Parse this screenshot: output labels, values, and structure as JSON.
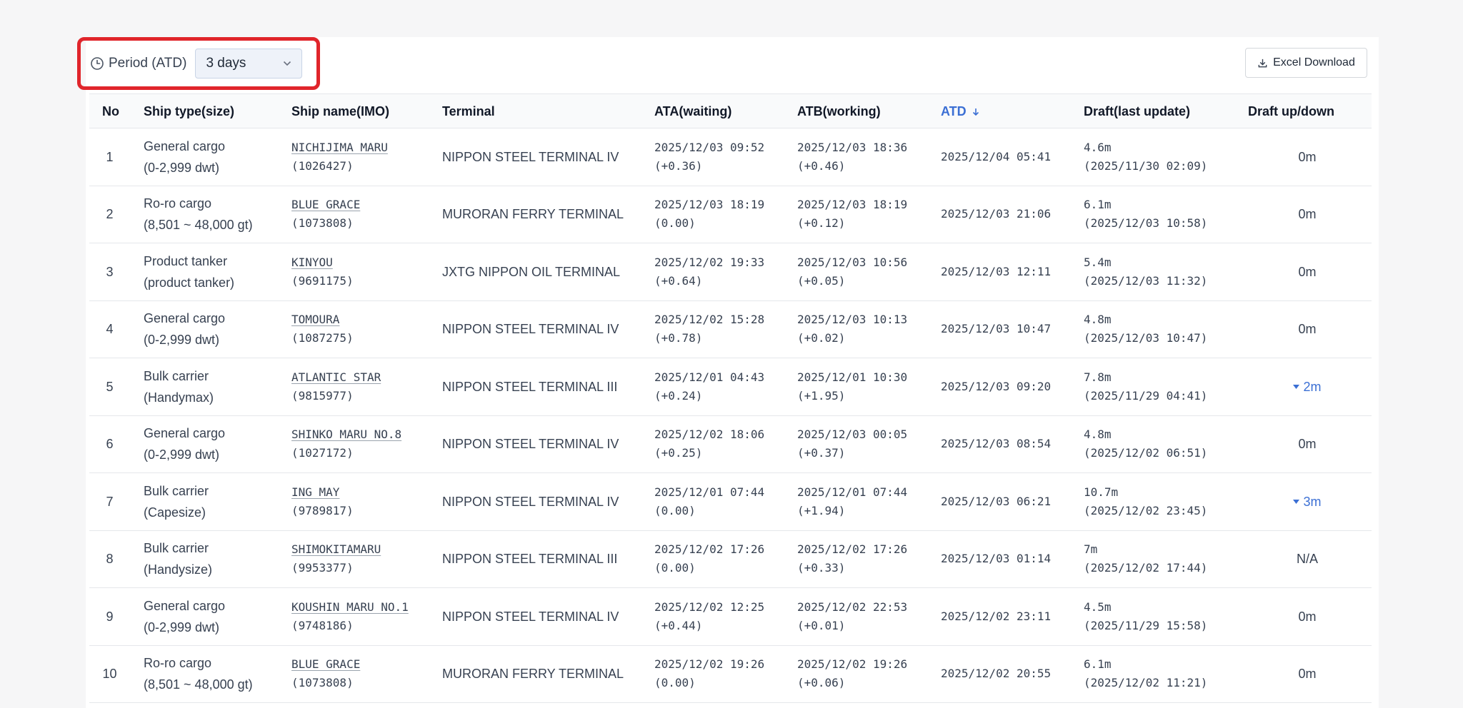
{
  "toolbar": {
    "period_label": "Period (ATD)",
    "period_value": "3 days",
    "excel_label": "Excel Download"
  },
  "columns": {
    "no": "No",
    "ship_type": "Ship type(size)",
    "ship_name": "Ship name(IMO)",
    "terminal": "Terminal",
    "ata": "ATA(waiting)",
    "atb": "ATB(working)",
    "atd": "ATD",
    "draft": "Draft(last update)",
    "updown": "Draft up/down"
  },
  "rows": [
    {
      "no": "1",
      "type": "General cargo",
      "size": "(0-2,999 dwt)",
      "name": "NICHIJIMA MARU",
      "imo": "(1026427)",
      "terminal": "NIPPON STEEL TERMINAL IV",
      "ata": "2025/12/03 09:52",
      "ata_wait": "(+0.36)",
      "atb": "2025/12/03 18:36",
      "atb_work": "(+0.46)",
      "atd": "2025/12/04 05:41",
      "draft": "4.6m",
      "draft_update": "(2025/11/30 02:09)",
      "updown": "0m",
      "updown_dir": "none"
    },
    {
      "no": "2",
      "type": "Ro-ro cargo",
      "size": "(8,501 ~ 48,000 gt)",
      "name": "BLUE GRACE",
      "imo": "(1073808)",
      "terminal": "MURORAN FERRY TERMINAL",
      "ata": "2025/12/03 18:19",
      "ata_wait": "(0.00)",
      "atb": "2025/12/03 18:19",
      "atb_work": "(+0.12)",
      "atd": "2025/12/03 21:06",
      "draft": "6.1m",
      "draft_update": "(2025/12/03 10:58)",
      "updown": "0m",
      "updown_dir": "none"
    },
    {
      "no": "3",
      "type": "Product tanker",
      "size": "(product tanker)",
      "name": "KINYOU",
      "imo": "(9691175)",
      "terminal": "JXTG NIPPON OIL TERMINAL",
      "ata": "2025/12/02 19:33",
      "ata_wait": "(+0.64)",
      "atb": "2025/12/03 10:56",
      "atb_work": "(+0.05)",
      "atd": "2025/12/03 12:11",
      "draft": "5.4m",
      "draft_update": "(2025/12/03 11:32)",
      "updown": "0m",
      "updown_dir": "none"
    },
    {
      "no": "4",
      "type": "General cargo",
      "size": "(0-2,999 dwt)",
      "name": "TOMOURA",
      "imo": "(1087275)",
      "terminal": "NIPPON STEEL TERMINAL IV",
      "ata": "2025/12/02 15:28",
      "ata_wait": "(+0.78)",
      "atb": "2025/12/03 10:13",
      "atb_work": "(+0.02)",
      "atd": "2025/12/03 10:47",
      "draft": "4.8m",
      "draft_update": "(2025/12/03 10:47)",
      "updown": "0m",
      "updown_dir": "none"
    },
    {
      "no": "5",
      "type": "Bulk carrier",
      "size": "(Handymax)",
      "name": "ATLANTIC STAR",
      "imo": "(9815977)",
      "terminal": "NIPPON STEEL TERMINAL III",
      "ata": "2025/12/01 04:43",
      "ata_wait": "(+0.24)",
      "atb": "2025/12/01 10:30",
      "atb_work": "(+1.95)",
      "atd": "2025/12/03 09:20",
      "draft": "7.8m",
      "draft_update": "(2025/11/29 04:41)",
      "updown": "2m",
      "updown_dir": "down"
    },
    {
      "no": "6",
      "type": "General cargo",
      "size": "(0-2,999 dwt)",
      "name": "SHINKO MARU NO.8",
      "imo": "(1027172)",
      "terminal": "NIPPON STEEL TERMINAL IV",
      "ata": "2025/12/02 18:06",
      "ata_wait": "(+0.25)",
      "atb": "2025/12/03 00:05",
      "atb_work": "(+0.37)",
      "atd": "2025/12/03 08:54",
      "draft": "4.8m",
      "draft_update": "(2025/12/02 06:51)",
      "updown": "0m",
      "updown_dir": "none"
    },
    {
      "no": "7",
      "type": "Bulk carrier",
      "size": "(Capesize)",
      "name": "ING MAY",
      "imo": "(9789817)",
      "terminal": "NIPPON STEEL TERMINAL IV",
      "ata": "2025/12/01 07:44",
      "ata_wait": "(0.00)",
      "atb": "2025/12/01 07:44",
      "atb_work": "(+1.94)",
      "atd": "2025/12/03 06:21",
      "draft": "10.7m",
      "draft_update": "(2025/12/02 23:45)",
      "updown": "3m",
      "updown_dir": "down"
    },
    {
      "no": "8",
      "type": "Bulk carrier",
      "size": "(Handysize)",
      "name": "SHIMOKITAMARU",
      "imo": "(9953377)",
      "terminal": "NIPPON STEEL TERMINAL III",
      "ata": "2025/12/02 17:26",
      "ata_wait": "(0.00)",
      "atb": "2025/12/02 17:26",
      "atb_work": "(+0.33)",
      "atd": "2025/12/03 01:14",
      "draft": "7m",
      "draft_update": "(2025/12/02 17:44)",
      "updown": "N/A",
      "updown_dir": "none"
    },
    {
      "no": "9",
      "type": "General cargo",
      "size": "(0-2,999 dwt)",
      "name": "KOUSHIN MARU NO.1",
      "imo": "(9748186)",
      "terminal": "NIPPON STEEL TERMINAL IV",
      "ata": "2025/12/02 12:25",
      "ata_wait": "(+0.44)",
      "atb": "2025/12/02 22:53",
      "atb_work": "(+0.01)",
      "atd": "2025/12/02 23:11",
      "draft": "4.5m",
      "draft_update": "(2025/11/29 15:58)",
      "updown": "0m",
      "updown_dir": "none"
    },
    {
      "no": "10",
      "type": "Ro-ro cargo",
      "size": "(8,501 ~ 48,000 gt)",
      "name": "BLUE GRACE",
      "imo": "(1073808)",
      "terminal": "MURORAN FERRY TERMINAL",
      "ata": "2025/12/02 19:26",
      "ata_wait": "(0.00)",
      "atb": "2025/12/02 19:26",
      "atb_work": "(+0.06)",
      "atd": "2025/12/02 20:55",
      "draft": "6.1m",
      "draft_update": "(2025/12/02 11:21)",
      "updown": "0m",
      "updown_dir": "none"
    }
  ],
  "colors": {
    "accent": "#3b6fd4",
    "highlight_border": "#e0252b"
  }
}
